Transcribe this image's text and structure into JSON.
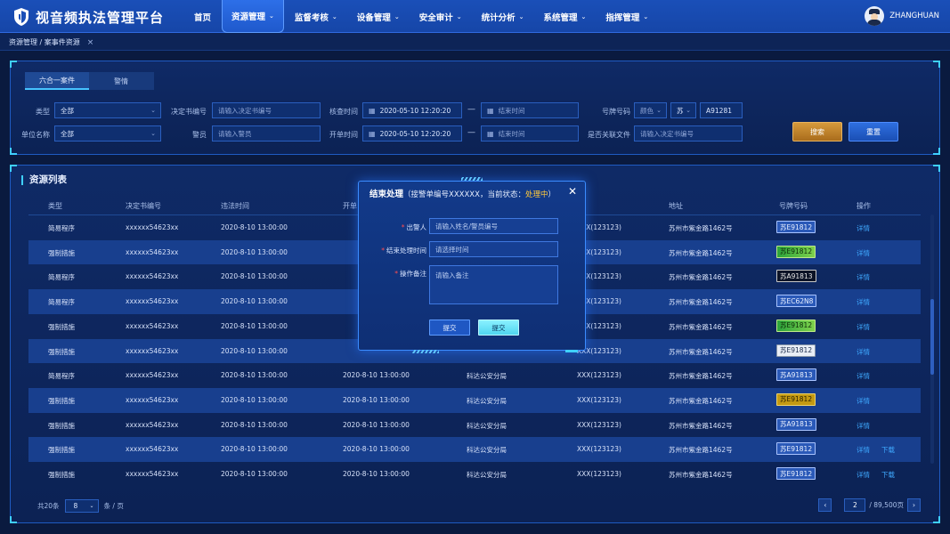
{
  "app": {
    "title": "视音频执法管理平台",
    "user": "ZHANGHUAN"
  },
  "nav": [
    {
      "label": "首页",
      "chev": false
    },
    {
      "label": "资源管理",
      "chev": true,
      "active": true
    },
    {
      "label": "监督考核",
      "chev": true
    },
    {
      "label": "设备管理",
      "chev": true
    },
    {
      "label": "安全审计",
      "chev": true
    },
    {
      "label": "统计分析",
      "chev": true
    },
    {
      "label": "系统管理",
      "chev": true
    },
    {
      "label": "指挥管理",
      "chev": true
    }
  ],
  "breadcrumb": {
    "label": "资源管理 / 案事件资源",
    "close": "×"
  },
  "filter": {
    "tabs": [
      "六合一案件",
      "警情"
    ],
    "type_label": "类型",
    "type_value": "全部",
    "decision_label": "决定书编号",
    "decision_placeholder": "请输入决定书编号",
    "verify_label": "核查时间",
    "verify_start": "2020-05-10  12:20:20",
    "verify_end": "结束时间",
    "plate_label": "号牌号码",
    "plate_color": "颜色",
    "plate_province": "苏",
    "plate_number": "A91281",
    "unit_label": "单位名称",
    "unit_value": "全部",
    "officer_label": "警员",
    "officer_placeholder": "请输入警员",
    "open_label": "开单时间",
    "open_start": "2020-05-10  12:20:20",
    "open_end": "结束时间",
    "file_label": "是否关联文件",
    "file_placeholder": "请输入决定书编号",
    "dash": "—",
    "search_btn": "搜索",
    "reset_btn": "重置"
  },
  "list": {
    "title": "资源列表",
    "columns": [
      "类型",
      "决定书编号",
      "违法时间",
      "开单",
      "",
      "",
      "地址",
      "号牌号码",
      "操作"
    ],
    "rows": [
      {
        "type": "简易程序",
        "no": "xxxxxx54623xx",
        "time": "2020-8-10 13:00:00",
        "open": "",
        "unit": "",
        "code": "XXX(123123)",
        "addr": "苏州市紫金路1462号",
        "plate": "苏E91812",
        "plate_style": "blue",
        "ops": [
          "详情"
        ]
      },
      {
        "type": "强制措施",
        "no": "xxxxxx54623xx",
        "time": "2020-8-10 13:00:00",
        "open": "",
        "unit": "",
        "code": "XXX(123123)",
        "addr": "苏州市紫金路1462号",
        "plate": "苏E91812",
        "plate_style": "green",
        "ops": [
          "详情"
        ]
      },
      {
        "type": "简易程序",
        "no": "xxxxxx54623xx",
        "time": "2020-8-10 13:00:00",
        "open": "",
        "unit": "",
        "code": "XXX(123123)",
        "addr": "苏州市紫金路1462号",
        "plate": "苏A91813",
        "plate_style": "black",
        "ops": [
          "详情"
        ]
      },
      {
        "type": "简易程序",
        "no": "xxxxxx54623xx",
        "time": "2020-8-10 13:00:00",
        "open": "",
        "unit": "",
        "code": "XXX(123123)",
        "addr": "苏州市紫金路1462号",
        "plate": "苏EC62N8",
        "plate_style": "blue",
        "ops": [
          "详情"
        ]
      },
      {
        "type": "强制措施",
        "no": "xxxxxx54623xx",
        "time": "2020-8-10 13:00:00",
        "open": "",
        "unit": "",
        "code": "XXX(123123)",
        "addr": "苏州市紫金路1462号",
        "plate": "苏E91812",
        "plate_style": "green",
        "ops": [
          "详情"
        ]
      },
      {
        "type": "强制措施",
        "no": "xxxxxx54623xx",
        "time": "2020-8-10 13:00:00",
        "open": "",
        "unit": "",
        "code": "XXX(123123)",
        "addr": "苏州市紫金路1462号",
        "plate": "苏E91812",
        "plate_style": "white",
        "ops": [
          "详情"
        ]
      },
      {
        "type": "简易程序",
        "no": "xxxxxx54623xx",
        "time": "2020-8-10 13:00:00",
        "open": "2020-8-10 13:00:00",
        "unit": "科达公安分局",
        "code": "XXX(123123)",
        "addr": "苏州市紫金路1462号",
        "plate": "苏A91813",
        "plate_style": "blue",
        "ops": [
          "详情"
        ]
      },
      {
        "type": "强制措施",
        "no": "xxxxxx54623xx",
        "time": "2020-8-10 13:00:00",
        "open": "2020-8-10 13:00:00",
        "unit": "科达公安分局",
        "code": "XXX(123123)",
        "addr": "苏州市紫金路1462号",
        "plate": "苏E91812",
        "plate_style": "yellow",
        "ops": [
          "详情"
        ]
      },
      {
        "type": "强制措施",
        "no": "xxxxxx54623xx",
        "time": "2020-8-10 13:00:00",
        "open": "2020-8-10 13:00:00",
        "unit": "科达公安分局",
        "code": "XXX(123123)",
        "addr": "苏州市紫金路1462号",
        "plate": "苏A91813",
        "plate_style": "blue",
        "ops": [
          "详情"
        ]
      },
      {
        "type": "强制措施",
        "no": "xxxxxx54623xx",
        "time": "2020-8-10 13:00:00",
        "open": "2020-8-10 13:00:00",
        "unit": "科达公安分局",
        "code": "XXX(123123)",
        "addr": "苏州市紫金路1462号",
        "plate": "苏E91812",
        "plate_style": "blue",
        "ops": [
          "详情",
          "下载"
        ]
      },
      {
        "type": "强制措施",
        "no": "xxxxxx54623xx",
        "time": "2020-8-10 13:00:00",
        "open": "2020-8-10 13:00:00",
        "unit": "科达公安分局",
        "code": "XXX(123123)",
        "addr": "苏州市紫金路1462号",
        "plate": "苏E91812",
        "plate_style": "blue",
        "ops": [
          "详情",
          "下载"
        ]
      }
    ]
  },
  "pager": {
    "total": "共20条",
    "size": "8",
    "unit": "条 / 页",
    "prev": "‹",
    "next": "›",
    "current": "2",
    "total_pages": "/ 89,500页"
  },
  "modal": {
    "title": "结束处理",
    "subtitle": "（接警单编号XXXXXX，当前状态：",
    "status": "处理中",
    "subtitle_end": "）",
    "close": "✕",
    "fields": [
      {
        "label": "出警人",
        "placeholder": "请输入姓名/警员编号"
      },
      {
        "label": "结束处理时间",
        "placeholder": "请选择时间"
      },
      {
        "label": "操作备注",
        "placeholder": "请输入备注"
      }
    ],
    "btn1": "提交",
    "btn2": "提交"
  },
  "colors": {
    "accent": "#3fd0ff",
    "status": "#ffc93b",
    "bg": "#0a1a3f"
  }
}
